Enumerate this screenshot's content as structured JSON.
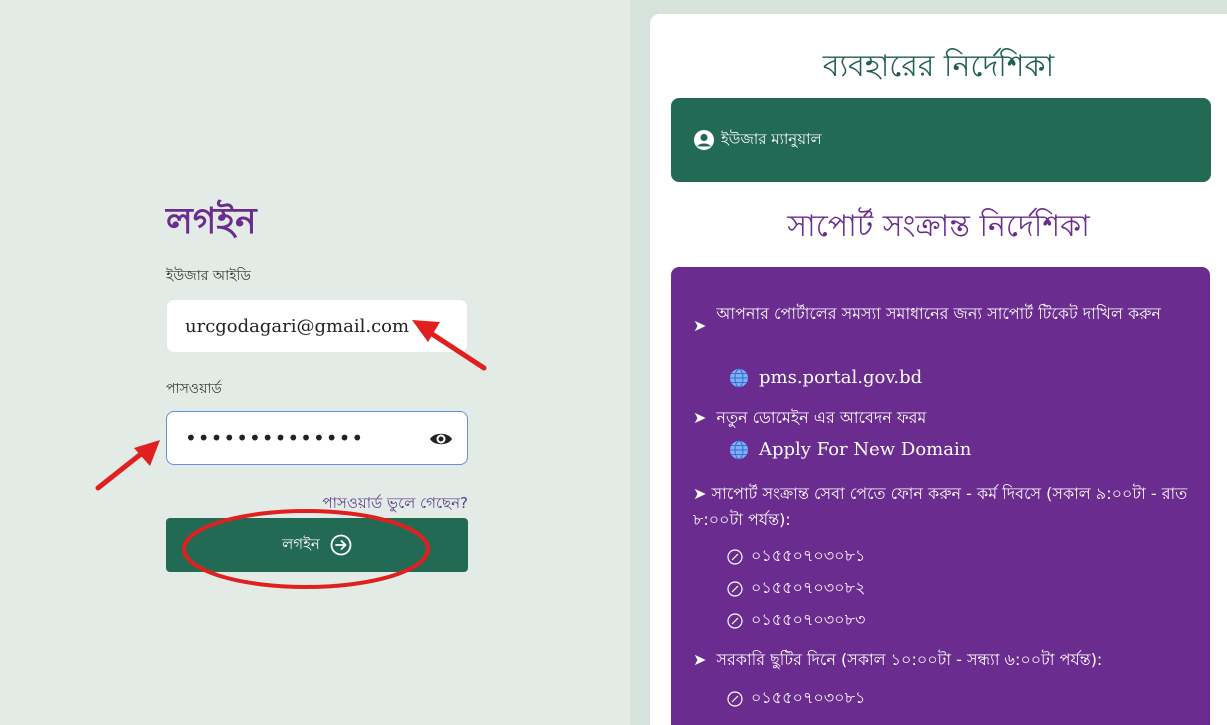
{
  "login": {
    "title": "লগইন",
    "user_label": "ইউজার আইডি",
    "user_value": "urcgodagari@gmail.com",
    "password_label": "পাসওয়ার্ড",
    "password_value": "••••••••••••••",
    "forgot_link": "পাসওয়ার্ড ভুলে গেছেন?",
    "submit_label": "লগইন"
  },
  "guide": {
    "title": "ব্যবহারের নির্দেশিকা",
    "manual_label": "ইউজার ম্যানুয়াল",
    "support_title": "সাপোর্ট সংক্রান্ত নির্দেশিকা",
    "items": [
      {
        "text": "আপনার পোর্টালের সমস্যা সমাধানের জন্য সাপোর্ট টিকেট দাখিল করুন",
        "link": "pms.portal.gov.bd"
      },
      {
        "text": "নতুন ডোমেইন এর আবেদন ফরম",
        "link": "Apply For New Domain"
      },
      {
        "text": "সাপোর্ট সংক্রান্ত সেবা পেতে ফোন করুন - কর্ম দিবসে (সকাল ৯:০০টা - রাত ৮:০০টা পর্যন্ত):"
      },
      {
        "text": "সরকারি ছুটির দিনে (সকাল ১০:০০টা - সন্ধ্যা ৬:০০টা পর্যন্ত):"
      }
    ],
    "phones_workday": [
      "০১৫৫০৭০৩০৮১",
      "০১৫৫০৭০৩০৮২",
      "০১৫৫০৭০৩০৮৩"
    ],
    "phones_holiday": [
      "০১৫৫০৭০৩০৮১"
    ]
  },
  "colors": {
    "brand_green": "#236a55",
    "brand_purple": "#6a2c8e",
    "annotation_red": "#e0201f"
  }
}
